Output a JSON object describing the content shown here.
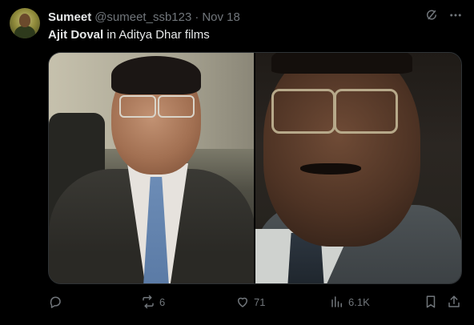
{
  "post": {
    "author_name": "Sumeet",
    "author_handle": "@sumeet_ssb123",
    "separator": "·",
    "date": "Nov 18",
    "text_bold": "Ajit Doval",
    "text_rest": " in Aditya Dhar films"
  },
  "media": {
    "left_image": "man-in-suit-glasses-photo",
    "right_image": "man-in-suit-glasses-photo"
  },
  "actions": {
    "reply_count": "",
    "repost_count": "6",
    "like_count": "71",
    "views_count": "6.1K"
  },
  "icons": {
    "grok": "grok-icon",
    "more": "more-icon",
    "reply": "reply-icon",
    "repost": "repost-icon",
    "like": "like-icon",
    "views": "views-icon",
    "bookmark": "bookmark-icon",
    "share": "share-icon"
  },
  "colors": {
    "background": "#000000",
    "text": "#e7e9ea",
    "muted": "#71767b",
    "border": "#2f3336"
  }
}
